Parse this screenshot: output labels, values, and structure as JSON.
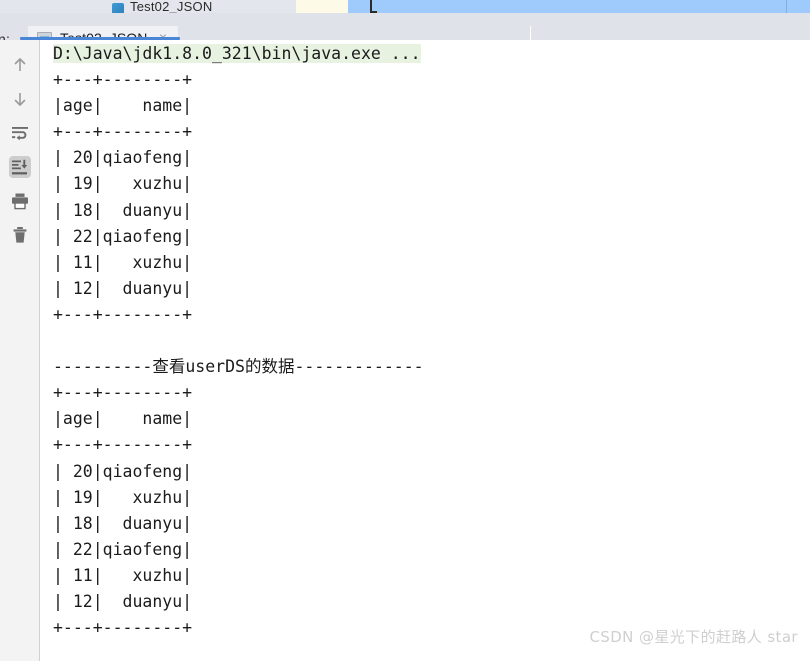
{
  "window": {
    "tool_window_label": "n:",
    "ghost_tab_label": "Test02_JSON"
  },
  "tab": {
    "label": "Test02_JSON",
    "close_label": "×",
    "icon": "run-configuration-icon"
  },
  "gutter": {
    "items": [
      {
        "name": "up-arrow-icon",
        "tooltip": "Up the Stack Trace",
        "selected": false
      },
      {
        "name": "down-arrow-icon",
        "tooltip": "Down the Stack Trace",
        "selected": false
      },
      {
        "name": "soft-wrap-icon",
        "tooltip": "Soft-Wrap",
        "selected": false
      },
      {
        "name": "scroll-to-end-icon",
        "tooltip": "Scroll to End",
        "selected": true
      },
      {
        "name": "print-icon",
        "tooltip": "Print",
        "selected": false
      },
      {
        "name": "trash-icon",
        "tooltip": "Clear All",
        "selected": false
      }
    ]
  },
  "console": {
    "command_line": "D:\\Java\\jdk1.8.0_321\\bin\\java.exe ...",
    "command_line_highlight": "#e7f2e0",
    "separator_label": "----------查看userDS的数据-------------",
    "separator_dashes_left": "----------",
    "separator_text_cjk_1": "查看",
    "separator_text_latin": "userDS",
    "separator_text_cjk_2": "的数据",
    "separator_dashes_right": "-------------",
    "table": {
      "border": "+---+--------+",
      "header": "|age|    name|",
      "columns": [
        "age",
        "name"
      ],
      "rows": [
        {
          "age": "20",
          "name": "qiaofeng",
          "line": "| 20|qiaofeng|"
        },
        {
          "age": "19",
          "name": "xuzhu",
          "line": "| 19|   xuzhu|"
        },
        {
          "age": "18",
          "name": "duanyu",
          "line": "| 18|  duanyu|"
        },
        {
          "age": "22",
          "name": "qiaofeng",
          "line": "| 22|qiaofeng|"
        },
        {
          "age": "11",
          "name": "xuzhu",
          "line": "| 11|   xuzhu|"
        },
        {
          "age": "12",
          "name": "duanyu",
          "line": "| 12|  duanyu|"
        }
      ]
    },
    "block1_text": "+---+--------+\n|age|    name|\n+---+--------+\n| 20|qiaofeng|\n| 19|   xuzhu|\n| 18|  duanyu|\n| 22|qiaofeng|\n| 11|   xuzhu|\n| 12|  duanyu|\n+---+--------+\n",
    "block2_text": "+---+--------+\n|age|    name|\n+---+--------+\n| 20|qiaofeng|\n| 19|   xuzhu|\n| 18|  duanyu|\n| 22|qiaofeng|\n| 11|   xuzhu|\n| 12|  duanyu|\n+---+--------+"
  },
  "watermark": {
    "text": "CSDN @星光下的赶路人 star"
  },
  "colors": {
    "tab_underline": "#4a86d8",
    "header_bg": "#dfe2e9",
    "gutter_bg": "#f3f3f3",
    "console_bg": "#ffffff",
    "cmd_highlight": "#e7f2e0",
    "watermark": "#cfcfcf"
  }
}
